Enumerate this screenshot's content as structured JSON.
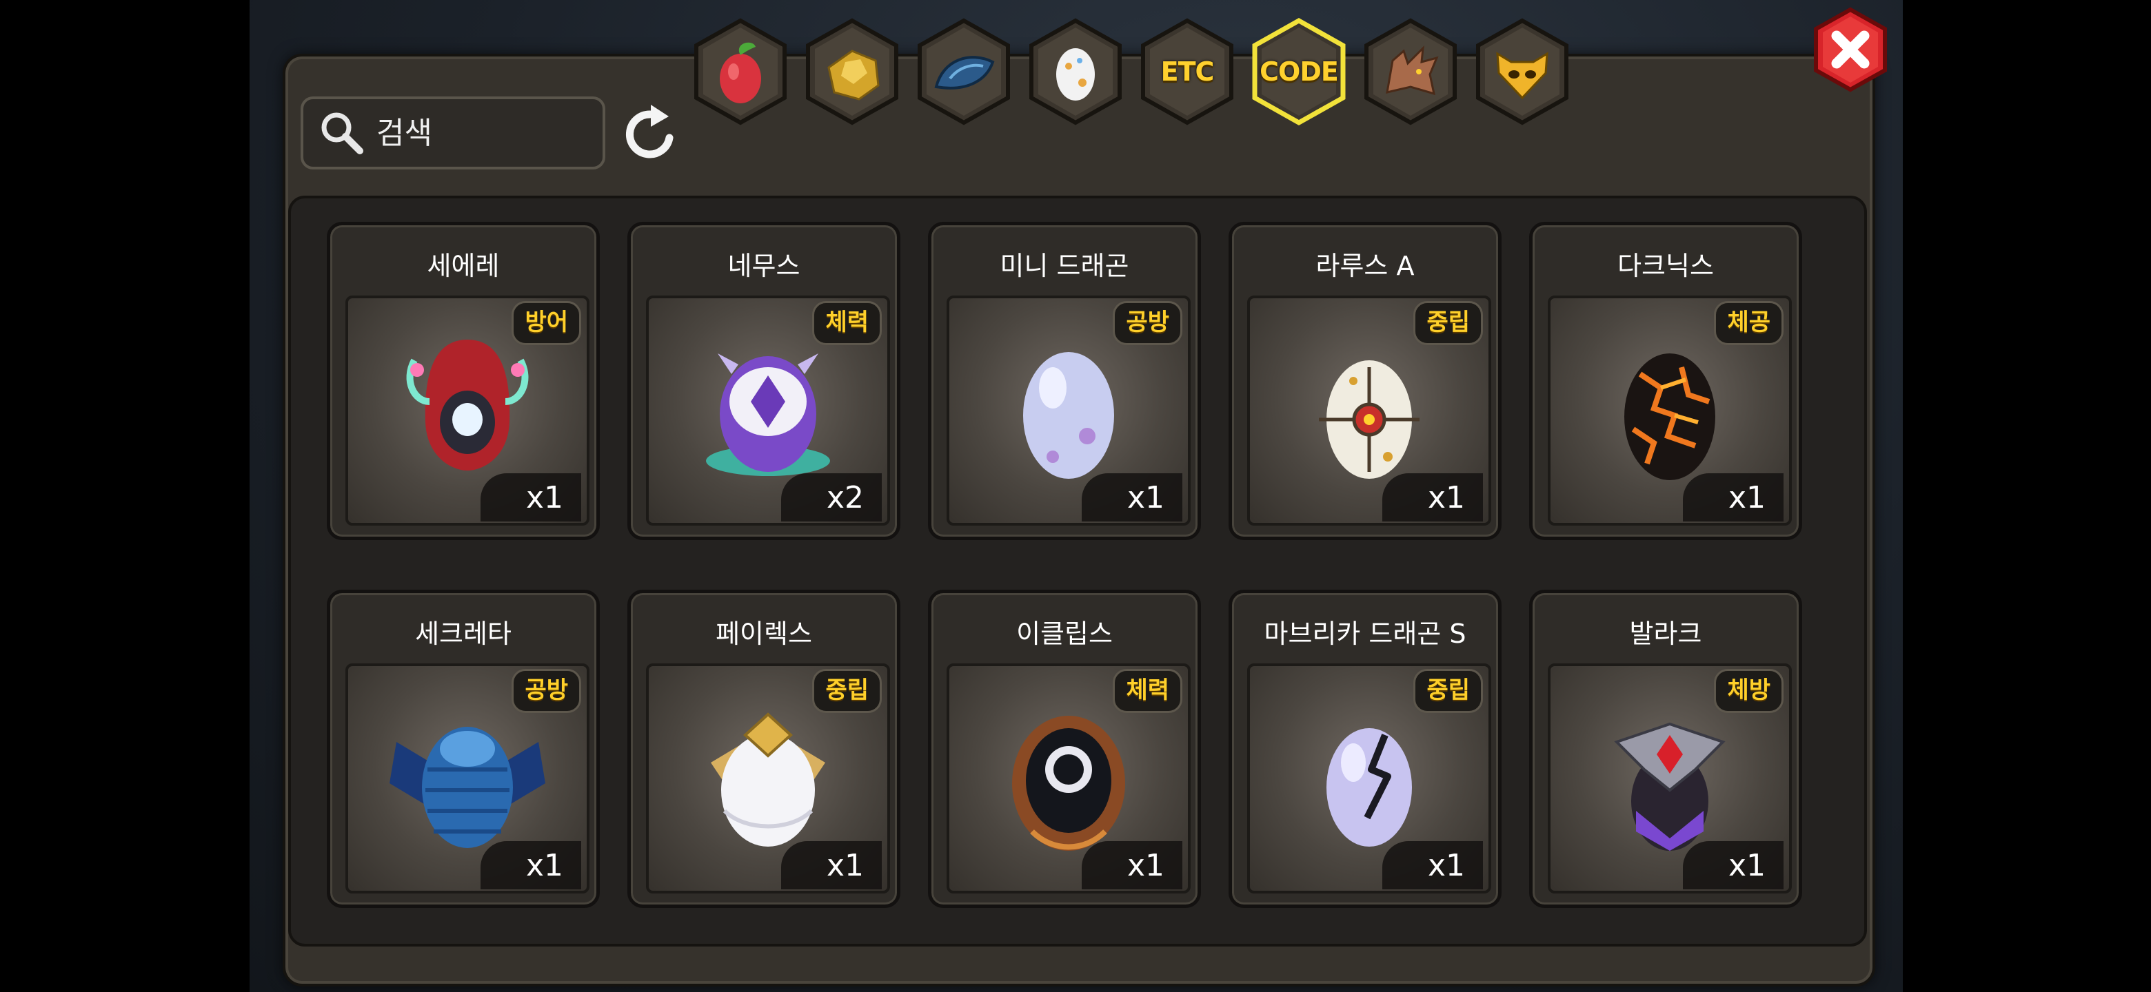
{
  "search": {
    "placeholder": "검색"
  },
  "tabs": [
    {
      "name": "tab-fruit",
      "icon": "fruit-icon"
    },
    {
      "name": "tab-gold",
      "icon": "gold-ore-icon"
    },
    {
      "name": "tab-material",
      "icon": "blue-scale-icon"
    },
    {
      "name": "tab-egg",
      "icon": "egg-icon"
    },
    {
      "name": "tab-etc",
      "label": "ETC"
    },
    {
      "name": "tab-code",
      "label": "CODE",
      "selected": true
    },
    {
      "name": "tab-dragon",
      "icon": "dragon-head-icon"
    },
    {
      "name": "tab-pet",
      "icon": "cat-face-icon"
    }
  ],
  "colors": {
    "accent": "#ffd12e",
    "selected_border": "#f2e23a",
    "close_red": "#d8242a"
  },
  "items": [
    {
      "name": "세에레",
      "type": "방어",
      "qty": "x1",
      "icon": "red-hood-egg-icon"
    },
    {
      "name": "네무스",
      "type": "체력",
      "qty": "x2",
      "icon": "purple-crystal-egg-icon"
    },
    {
      "name": "미니 드래곤",
      "type": "공방",
      "qty": "x1",
      "icon": "lavender-egg-icon"
    },
    {
      "name": "라루스 A",
      "type": "중립",
      "qty": "x1",
      "icon": "sun-sigil-egg-icon"
    },
    {
      "name": "다크닉스",
      "type": "체공",
      "qty": "x1",
      "icon": "lava-egg-icon"
    },
    {
      "name": "세크레타",
      "type": "공방",
      "qty": "x1",
      "icon": "blue-scaled-egg-icon"
    },
    {
      "name": "페이렉스",
      "type": "중립",
      "qty": "x1",
      "icon": "white-gold-egg-icon"
    },
    {
      "name": "이클립스",
      "type": "체력",
      "qty": "x1",
      "icon": "eclipse-egg-icon"
    },
    {
      "name": "마브리카 드래곤 S",
      "type": "중립",
      "qty": "x1",
      "icon": "cracked-egg-icon"
    },
    {
      "name": "발라크",
      "type": "체방",
      "qty": "x1",
      "icon": "ruby-crest-egg-icon"
    }
  ]
}
